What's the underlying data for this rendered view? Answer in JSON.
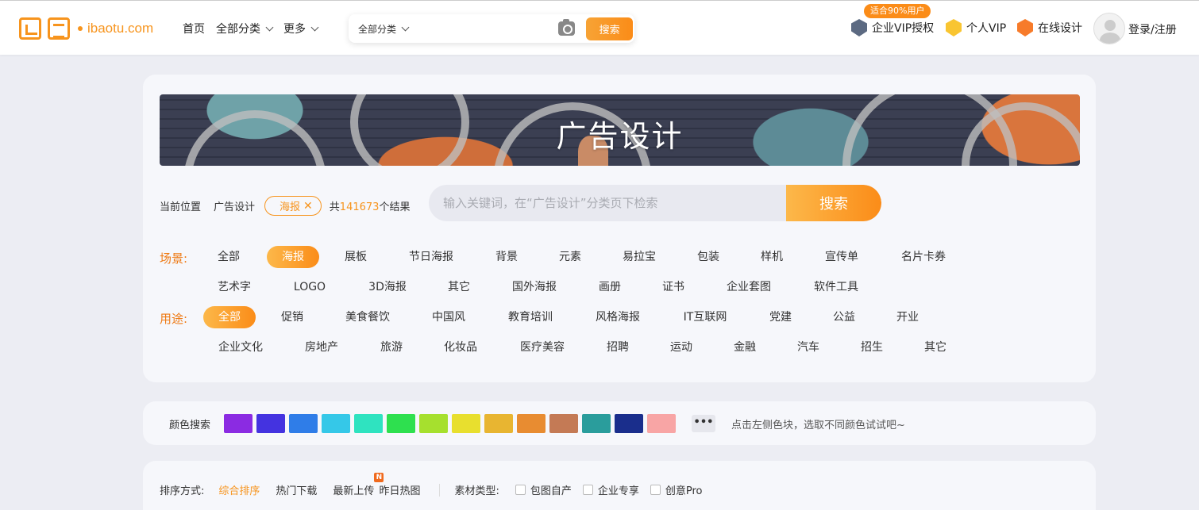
{
  "header": {
    "logo_text": "ibaotu.com",
    "nav": [
      {
        "label": "首页",
        "has_dropdown": false
      },
      {
        "label": "全部分类",
        "has_dropdown": true
      },
      {
        "label": "更多",
        "has_dropdown": true
      }
    ],
    "search": {
      "category": "全部分类",
      "placeholder": "",
      "button_label": "搜索",
      "camera_icon": "camera-icon"
    },
    "badge": "适合90%用户",
    "right_links": [
      {
        "label": "企业VIP授权",
        "icon": "enterprise-vip-icon"
      },
      {
        "label": "个人VIP",
        "icon": "personal-vip-icon"
      },
      {
        "label": "在线设计",
        "icon": "online-design-icon"
      }
    ],
    "login_label": "登录/注册"
  },
  "banner": {
    "title": "广告设计"
  },
  "breadcrumb": {
    "label": "当前位置",
    "category": "广告设计",
    "tag": "海报",
    "count_prefix": "共",
    "count": "141673",
    "count_suffix": "个结果"
  },
  "category_search": {
    "placeholder": "输入关键词，在“广告设计”分类页下检索",
    "button_label": "搜索"
  },
  "filters": {
    "scene": {
      "label": "场景:",
      "items": [
        "全部",
        "海报",
        "展板",
        "节日海报",
        "背景",
        "元素",
        "易拉宝",
        "包装",
        "样机",
        "宣传单",
        "名片卡券",
        "艺术字",
        "LOGO",
        "3D海报",
        "其它",
        "国外海报",
        "画册",
        "证书",
        "企业套图",
        "软件工具"
      ],
      "active": "海报"
    },
    "usage": {
      "label": "用途:",
      "items": [
        "全部",
        "促销",
        "美食餐饮",
        "中国风",
        "教育培训",
        "风格海报",
        "IT互联网",
        "党建",
        "公益",
        "开业",
        "企业文化",
        "房地产",
        "旅游",
        "化妆品",
        "医疗美容",
        "招聘",
        "运动",
        "金融",
        "汽车",
        "招生",
        "其它"
      ],
      "active": "全部"
    }
  },
  "color_search": {
    "label": "颜色搜索",
    "swatches": [
      "#8b2be2",
      "#4433e0",
      "#2f7de8",
      "#35c8e8",
      "#2fe3c0",
      "#2ee04f",
      "#a6e02e",
      "#e8df2e",
      "#e8b531",
      "#e88c31",
      "#c47a55",
      "#2a9d9c",
      "#1a2e8c",
      "#f8a5a5"
    ],
    "more_label": "•••",
    "hint": "点击左侧色块，选取不同颜色试试吧~"
  },
  "sort": {
    "label": "排序方式:",
    "options": [
      "综合排序",
      "热门下载",
      "最新上传",
      "昨日热图"
    ],
    "active": "综合排序",
    "new_badge": "N",
    "material_label": "素材类型:",
    "material_options": [
      "包图自产",
      "企业专享",
      "创意Pro"
    ]
  },
  "colors": {
    "accent": "#f7941d",
    "accent_gradient_end": "#fb8c18",
    "page_bg": "#ecedf3",
    "card_bg": "#f6f7fb"
  }
}
